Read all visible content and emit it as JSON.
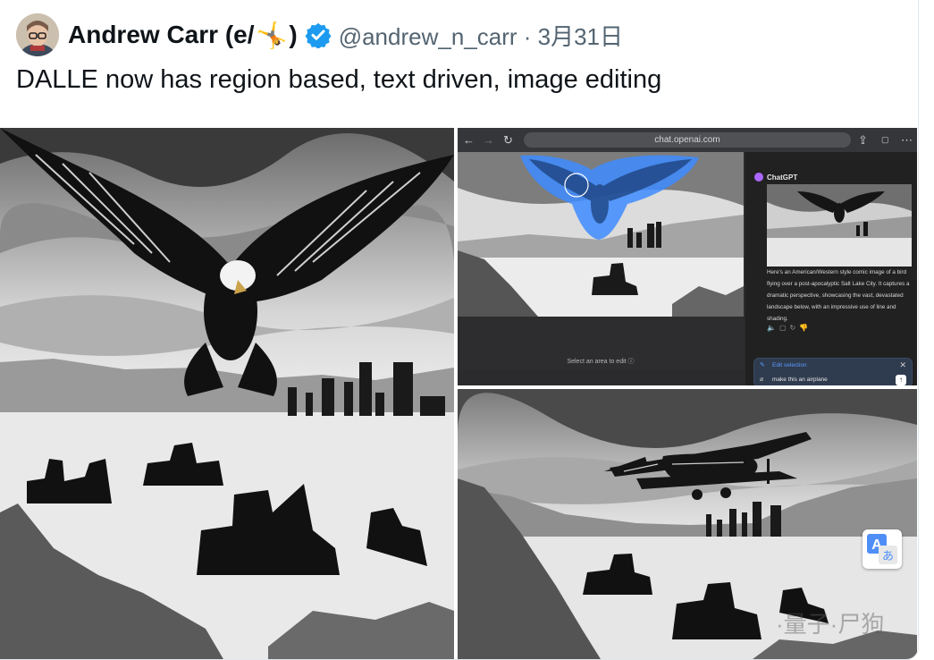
{
  "tweet": {
    "display_name": "Andrew Carr (e/",
    "display_name_close": ")",
    "emoji": "🤸",
    "handle_line": "@andrew_n_carr · 3月31日",
    "text": "DALLE now has region based, text driven, image editing"
  },
  "icons": {
    "avatar": "avatar",
    "verified": "verified-badge-icon",
    "translate": "translate-icon"
  },
  "colors": {
    "verified_blue": "#1d9bf0",
    "name_text": "#0f1419",
    "secondary_text": "#536471",
    "selection_blue": "#3d8bff"
  },
  "screenshot_panel": {
    "url": "chat.openai.com",
    "select_label": "Select an area to edit",
    "assistant_name": "ChatGPT",
    "assistant_text": "Here's an American/Western style comic image of a bird flying over a post-apocalyptic Salt Lake City. It captures a dramatic perspective, showcasing the vast, devastated landscape below, with an impressive use of line and shading.",
    "edit_selection_label": "Edit selection",
    "edit_input": "make this an airplane"
  },
  "watermark": "·量子·尸狗"
}
